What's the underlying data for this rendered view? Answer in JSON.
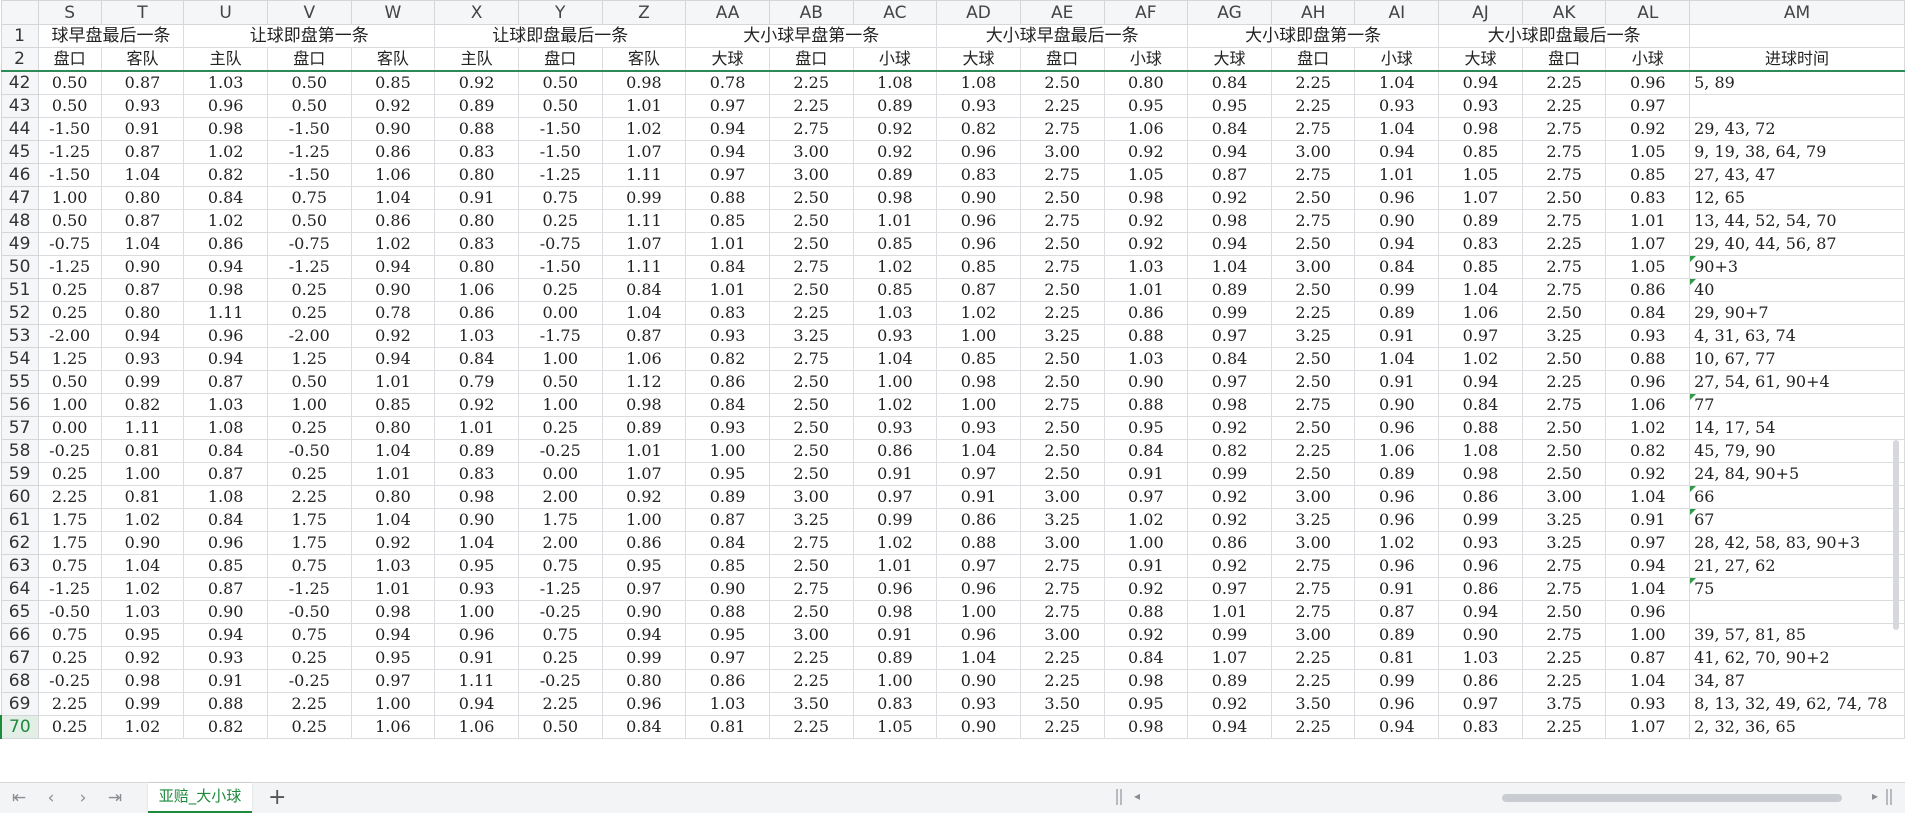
{
  "columns": [
    "S",
    "T",
    "U",
    "V",
    "W",
    "X",
    "Y",
    "Z",
    "AA",
    "AB",
    "AC",
    "AD",
    "AE",
    "AF",
    "AG",
    "AH",
    "AI",
    "AJ",
    "AK",
    "AL",
    "AM"
  ],
  "row1": {
    "row_number": "1",
    "groups": [
      {
        "label": "球早盘最后一条",
        "span": 2
      },
      {
        "label": "让球即盘第一条",
        "span": 3
      },
      {
        "label": "让球即盘最后一条",
        "span": 3
      },
      {
        "label": "大小球早盘第一条",
        "span": 3
      },
      {
        "label": "大小球早盘最后一条",
        "span": 3
      },
      {
        "label": "大小球即盘第一条",
        "span": 3
      },
      {
        "label": "大小球即盘最后一条",
        "span": 3
      },
      {
        "label": "",
        "span": 1
      }
    ]
  },
  "row2": {
    "row_number": "2",
    "labels": [
      "盘口",
      "客队",
      "主队",
      "盘口",
      "客队",
      "主队",
      "盘口",
      "客队",
      "大球",
      "盘口",
      "小球",
      "大球",
      "盘口",
      "小球",
      "大球",
      "盘口",
      "小球",
      "大球",
      "盘口",
      "小球",
      "进球时间"
    ]
  },
  "rows": [
    {
      "n": "42",
      "v": [
        "0.50",
        "0.87",
        "1.03",
        "0.50",
        "0.85",
        "0.92",
        "0.50",
        "0.98",
        "0.78",
        "2.25",
        "1.08",
        "1.08",
        "2.50",
        "0.80",
        "0.84",
        "2.25",
        "1.04",
        "0.94",
        "2.25",
        "0.96"
      ],
      "goals": "5, 89",
      "mark": false
    },
    {
      "n": "43",
      "v": [
        "0.50",
        "0.93",
        "0.96",
        "0.50",
        "0.92",
        "0.89",
        "0.50",
        "1.01",
        "0.97",
        "2.25",
        "0.89",
        "0.93",
        "2.25",
        "0.95",
        "0.95",
        "2.25",
        "0.93",
        "0.93",
        "2.25",
        "0.97"
      ],
      "goals": "",
      "mark": false
    },
    {
      "n": "44",
      "v": [
        "-1.50",
        "0.91",
        "0.98",
        "-1.50",
        "0.90",
        "0.88",
        "-1.50",
        "1.02",
        "0.94",
        "2.75",
        "0.92",
        "0.82",
        "2.75",
        "1.06",
        "0.84",
        "2.75",
        "1.04",
        "0.98",
        "2.75",
        "0.92"
      ],
      "goals": "29, 43, 72",
      "mark": false
    },
    {
      "n": "45",
      "v": [
        "-1.25",
        "0.87",
        "1.02",
        "-1.25",
        "0.86",
        "0.83",
        "-1.50",
        "1.07",
        "0.94",
        "3.00",
        "0.92",
        "0.96",
        "3.00",
        "0.92",
        "0.94",
        "3.00",
        "0.94",
        "0.85",
        "2.75",
        "1.05"
      ],
      "goals": "9, 19, 38, 64, 79",
      "mark": false
    },
    {
      "n": "46",
      "v": [
        "-1.50",
        "1.04",
        "0.82",
        "-1.50",
        "1.06",
        "0.80",
        "-1.25",
        "1.11",
        "0.97",
        "3.00",
        "0.89",
        "0.83",
        "2.75",
        "1.05",
        "0.87",
        "2.75",
        "1.01",
        "1.05",
        "2.75",
        "0.85"
      ],
      "goals": "27, 43, 47",
      "mark": false
    },
    {
      "n": "47",
      "v": [
        "1.00",
        "0.80",
        "0.84",
        "0.75",
        "1.04",
        "0.91",
        "0.75",
        "0.99",
        "0.88",
        "2.50",
        "0.98",
        "0.90",
        "2.50",
        "0.98",
        "0.92",
        "2.50",
        "0.96",
        "1.07",
        "2.50",
        "0.83"
      ],
      "goals": "12, 65",
      "mark": false
    },
    {
      "n": "48",
      "v": [
        "0.50",
        "0.87",
        "1.02",
        "0.50",
        "0.86",
        "0.80",
        "0.25",
        "1.11",
        "0.85",
        "2.50",
        "1.01",
        "0.96",
        "2.75",
        "0.92",
        "0.98",
        "2.75",
        "0.90",
        "0.89",
        "2.75",
        "1.01"
      ],
      "goals": "13, 44, 52, 54, 70",
      "mark": false
    },
    {
      "n": "49",
      "v": [
        "-0.75",
        "1.04",
        "0.86",
        "-0.75",
        "1.02",
        "0.83",
        "-0.75",
        "1.07",
        "1.01",
        "2.50",
        "0.85",
        "0.96",
        "2.50",
        "0.92",
        "0.94",
        "2.50",
        "0.94",
        "0.83",
        "2.25",
        "1.07"
      ],
      "goals": "29, 40, 44, 56, 87",
      "mark": false
    },
    {
      "n": "50",
      "v": [
        "-1.25",
        "0.90",
        "0.94",
        "-1.25",
        "0.94",
        "0.80",
        "-1.50",
        "1.11",
        "0.84",
        "2.75",
        "1.02",
        "0.85",
        "2.75",
        "1.03",
        "1.04",
        "3.00",
        "0.84",
        "0.85",
        "2.75",
        "1.05"
      ],
      "goals": "90+3",
      "mark": true
    },
    {
      "n": "51",
      "v": [
        "0.25",
        "0.87",
        "0.98",
        "0.25",
        "0.90",
        "1.06",
        "0.25",
        "0.84",
        "1.01",
        "2.50",
        "0.85",
        "0.87",
        "2.50",
        "1.01",
        "0.89",
        "2.50",
        "0.99",
        "1.04",
        "2.75",
        "0.86"
      ],
      "goals": "40",
      "mark": true
    },
    {
      "n": "52",
      "v": [
        "0.25",
        "0.80",
        "1.11",
        "0.25",
        "0.78",
        "0.86",
        "0.00",
        "1.04",
        "0.83",
        "2.25",
        "1.03",
        "1.02",
        "2.25",
        "0.86",
        "0.99",
        "2.25",
        "0.89",
        "1.06",
        "2.50",
        "0.84"
      ],
      "goals": "29, 90+7",
      "mark": false
    },
    {
      "n": "53",
      "v": [
        "-2.00",
        "0.94",
        "0.96",
        "-2.00",
        "0.92",
        "1.03",
        "-1.75",
        "0.87",
        "0.93",
        "3.25",
        "0.93",
        "1.00",
        "3.25",
        "0.88",
        "0.97",
        "3.25",
        "0.91",
        "0.97",
        "3.25",
        "0.93"
      ],
      "goals": "4, 31, 63, 74",
      "mark": false
    },
    {
      "n": "54",
      "v": [
        "1.25",
        "0.93",
        "0.94",
        "1.25",
        "0.94",
        "0.84",
        "1.00",
        "1.06",
        "0.82",
        "2.75",
        "1.04",
        "0.85",
        "2.50",
        "1.03",
        "0.84",
        "2.50",
        "1.04",
        "1.02",
        "2.50",
        "0.88"
      ],
      "goals": "10, 67, 77",
      "mark": false
    },
    {
      "n": "55",
      "v": [
        "0.50",
        "0.99",
        "0.87",
        "0.50",
        "1.01",
        "0.79",
        "0.50",
        "1.12",
        "0.86",
        "2.50",
        "1.00",
        "0.98",
        "2.50",
        "0.90",
        "0.97",
        "2.50",
        "0.91",
        "0.94",
        "2.25",
        "0.96"
      ],
      "goals": "27, 54, 61, 90+4",
      "mark": false
    },
    {
      "n": "56",
      "v": [
        "1.00",
        "0.82",
        "1.03",
        "1.00",
        "0.85",
        "0.92",
        "1.00",
        "0.98",
        "0.84",
        "2.50",
        "1.02",
        "1.00",
        "2.75",
        "0.88",
        "0.98",
        "2.75",
        "0.90",
        "0.84",
        "2.75",
        "1.06"
      ],
      "goals": "77",
      "mark": true
    },
    {
      "n": "57",
      "v": [
        "0.00",
        "1.11",
        "1.08",
        "0.25",
        "0.80",
        "1.01",
        "0.25",
        "0.89",
        "0.93",
        "2.50",
        "0.93",
        "0.93",
        "2.50",
        "0.95",
        "0.92",
        "2.50",
        "0.96",
        "0.88",
        "2.50",
        "1.02"
      ],
      "goals": "14, 17, 54",
      "mark": false
    },
    {
      "n": "58",
      "v": [
        "-0.25",
        "0.81",
        "0.84",
        "-0.50",
        "1.04",
        "0.89",
        "-0.25",
        "1.01",
        "1.00",
        "2.50",
        "0.86",
        "1.04",
        "2.50",
        "0.84",
        "0.82",
        "2.25",
        "1.06",
        "1.08",
        "2.50",
        "0.82"
      ],
      "goals": "45, 79, 90",
      "mark": false
    },
    {
      "n": "59",
      "v": [
        "0.25",
        "1.00",
        "0.87",
        "0.25",
        "1.01",
        "0.83",
        "0.00",
        "1.07",
        "0.95",
        "2.50",
        "0.91",
        "0.97",
        "2.50",
        "0.91",
        "0.99",
        "2.50",
        "0.89",
        "0.98",
        "2.50",
        "0.92"
      ],
      "goals": "24, 84, 90+5",
      "mark": false
    },
    {
      "n": "60",
      "v": [
        "2.25",
        "0.81",
        "1.08",
        "2.25",
        "0.80",
        "0.98",
        "2.00",
        "0.92",
        "0.89",
        "3.00",
        "0.97",
        "0.91",
        "3.00",
        "0.97",
        "0.92",
        "3.00",
        "0.96",
        "0.86",
        "3.00",
        "1.04"
      ],
      "goals": "66",
      "mark": true
    },
    {
      "n": "61",
      "v": [
        "1.75",
        "1.02",
        "0.84",
        "1.75",
        "1.04",
        "0.90",
        "1.75",
        "1.00",
        "0.87",
        "3.25",
        "0.99",
        "0.86",
        "3.25",
        "1.02",
        "0.92",
        "3.25",
        "0.96",
        "0.99",
        "3.25",
        "0.91"
      ],
      "goals": "67",
      "mark": true
    },
    {
      "n": "62",
      "v": [
        "1.75",
        "0.90",
        "0.96",
        "1.75",
        "0.92",
        "1.04",
        "2.00",
        "0.86",
        "0.84",
        "2.75",
        "1.02",
        "0.88",
        "3.00",
        "1.00",
        "0.86",
        "3.00",
        "1.02",
        "0.93",
        "3.25",
        "0.97"
      ],
      "goals": "28, 42, 58, 83, 90+3",
      "mark": false
    },
    {
      "n": "63",
      "v": [
        "0.75",
        "1.04",
        "0.85",
        "0.75",
        "1.03",
        "0.95",
        "0.75",
        "0.95",
        "0.85",
        "2.50",
        "1.01",
        "0.97",
        "2.75",
        "0.91",
        "0.92",
        "2.75",
        "0.96",
        "0.96",
        "2.75",
        "0.94"
      ],
      "goals": "21, 27, 62",
      "mark": false
    },
    {
      "n": "64",
      "v": [
        "-1.25",
        "1.02",
        "0.87",
        "-1.25",
        "1.01",
        "0.93",
        "-1.25",
        "0.97",
        "0.90",
        "2.75",
        "0.96",
        "0.96",
        "2.75",
        "0.92",
        "0.97",
        "2.75",
        "0.91",
        "0.86",
        "2.75",
        "1.04"
      ],
      "goals": "75",
      "mark": true
    },
    {
      "n": "65",
      "v": [
        "-0.50",
        "1.03",
        "0.90",
        "-0.50",
        "0.98",
        "1.00",
        "-0.25",
        "0.90",
        "0.88",
        "2.50",
        "0.98",
        "1.00",
        "2.75",
        "0.88",
        "1.01",
        "2.75",
        "0.87",
        "0.94",
        "2.50",
        "0.96"
      ],
      "goals": "",
      "mark": false
    },
    {
      "n": "66",
      "v": [
        "0.75",
        "0.95",
        "0.94",
        "0.75",
        "0.94",
        "0.96",
        "0.75",
        "0.94",
        "0.95",
        "3.00",
        "0.91",
        "0.96",
        "3.00",
        "0.92",
        "0.99",
        "3.00",
        "0.89",
        "0.90",
        "2.75",
        "1.00"
      ],
      "goals": "39, 57, 81, 85",
      "mark": false
    },
    {
      "n": "67",
      "v": [
        "0.25",
        "0.92",
        "0.93",
        "0.25",
        "0.95",
        "0.91",
        "0.25",
        "0.99",
        "0.97",
        "2.25",
        "0.89",
        "1.04",
        "2.25",
        "0.84",
        "1.07",
        "2.25",
        "0.81",
        "1.03",
        "2.25",
        "0.87"
      ],
      "goals": "41, 62, 70, 90+2",
      "mark": false
    },
    {
      "n": "68",
      "v": [
        "-0.25",
        "0.98",
        "0.91",
        "-0.25",
        "0.97",
        "1.11",
        "-0.25",
        "0.80",
        "0.86",
        "2.25",
        "1.00",
        "0.90",
        "2.25",
        "0.98",
        "0.89",
        "2.25",
        "0.99",
        "0.86",
        "2.25",
        "1.04"
      ],
      "goals": "34, 87",
      "mark": false
    },
    {
      "n": "69",
      "v": [
        "2.25",
        "0.99",
        "0.88",
        "2.25",
        "1.00",
        "0.94",
        "2.25",
        "0.96",
        "1.03",
        "3.50",
        "0.83",
        "0.93",
        "3.50",
        "0.95",
        "0.92",
        "3.50",
        "0.96",
        "0.97",
        "3.75",
        "0.93"
      ],
      "goals": "8, 13, 32, 49, 62, 74, 78",
      "mark": false
    },
    {
      "n": "70",
      "v": [
        "0.25",
        "1.02",
        "0.82",
        "0.25",
        "1.06",
        "1.06",
        "0.50",
        "0.84",
        "0.81",
        "2.25",
        "1.05",
        "0.90",
        "2.25",
        "0.98",
        "0.94",
        "2.25",
        "0.94",
        "0.83",
        "2.25",
        "1.07"
      ],
      "goals": "2, 32, 36, 65",
      "mark": false,
      "selected": true
    }
  ],
  "bottom": {
    "sheet_tab": "亚赔_大小球",
    "add_label": "+",
    "nav_first": "|<",
    "nav_prev": "<",
    "nav_next": ">",
    "nav_last": ">|"
  },
  "colors": {
    "accent": "#1e8a3c",
    "header_bg": "#f5f6f7",
    "grid": "#dadce0"
  }
}
